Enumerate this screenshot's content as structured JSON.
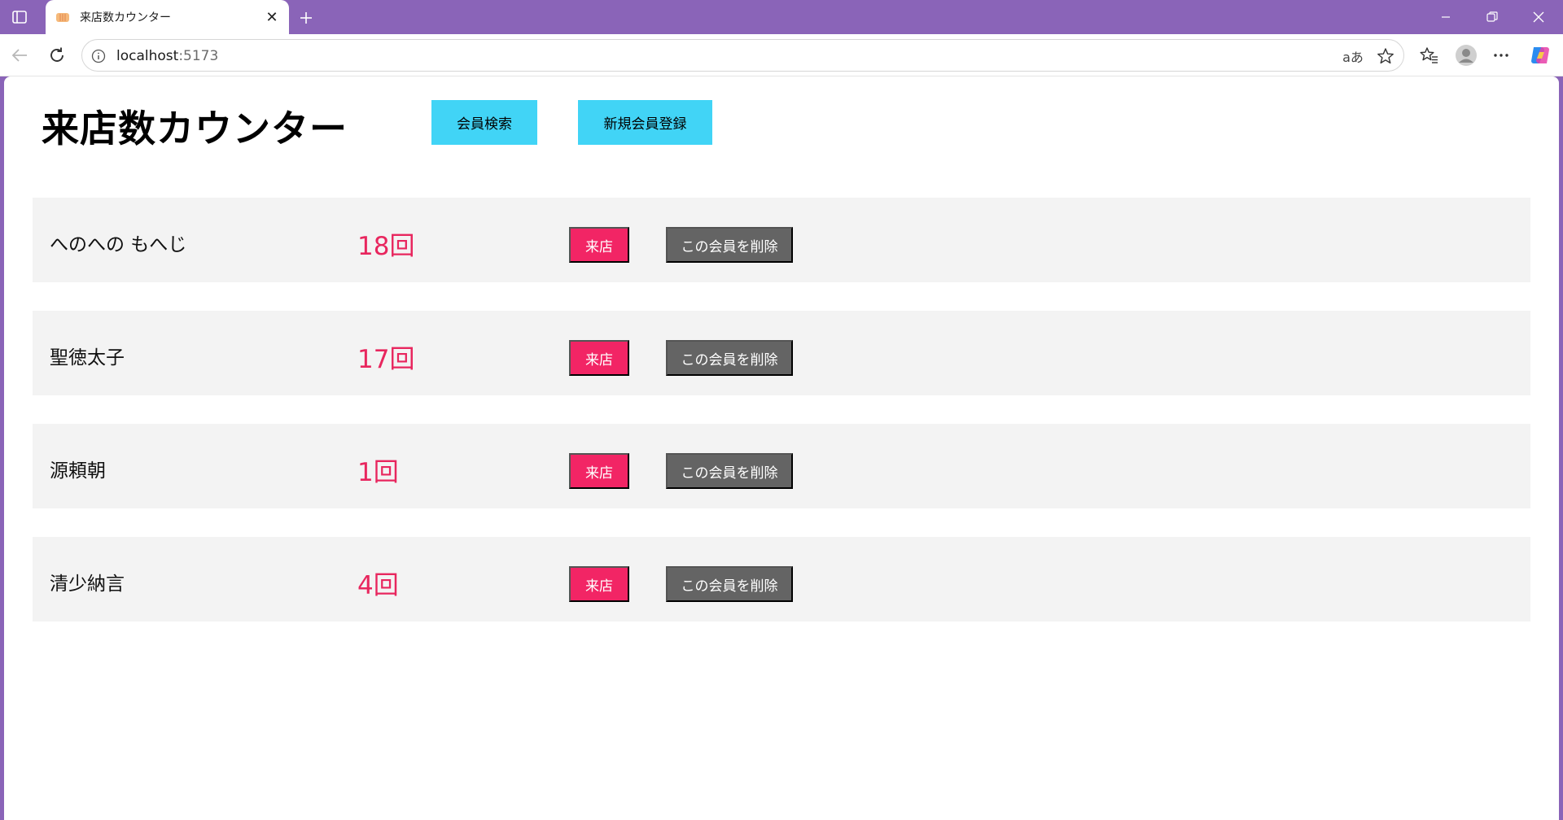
{
  "browser": {
    "tab_title": "来店数カウンター",
    "url_host": "localhost",
    "url_port": ":5173"
  },
  "app": {
    "title": "来店数カウンター",
    "search_button": "会員検索",
    "register_button": "新規会員登録"
  },
  "members": [
    {
      "name": "へのへの もへじ",
      "count": "18回",
      "visit_label": "来店",
      "delete_label": "この会員を削除"
    },
    {
      "name": "聖徳太子",
      "count": "17回",
      "visit_label": "来店",
      "delete_label": "この会員を削除"
    },
    {
      "name": "源頼朝",
      "count": "1回",
      "visit_label": "来店",
      "delete_label": "この会員を削除"
    },
    {
      "name": "清少納言",
      "count": "4回",
      "visit_label": "来店",
      "delete_label": "この会員を削除"
    }
  ],
  "colors": {
    "chrome_purple": "#8a64b8",
    "accent_cyan": "#41d4f6",
    "visit_pink": "#f22565",
    "count_pink": "#e8265e",
    "delete_gray": "#646464",
    "row_bg": "#f3f3f3"
  },
  "icons": [
    "sidebar-icon",
    "favicon-icon",
    "close-icon",
    "plus-icon",
    "minimize-icon",
    "restore-icon",
    "back-icon",
    "reload-icon",
    "info-icon",
    "read-aloud-icon",
    "favorite-star-icon",
    "favorites-icon",
    "profile-icon",
    "more-icon",
    "copilot-icon"
  ]
}
